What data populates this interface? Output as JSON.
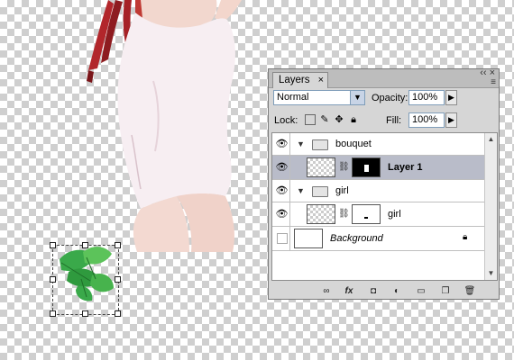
{
  "panel": {
    "tab_label": "Layers",
    "tab_close": "×",
    "window_controls": "‹‹ ×",
    "menu_icon": "≡",
    "blend_mode": "Normal",
    "opacity_label": "Opacity:",
    "opacity_value": "100%",
    "lock_label": "Lock:",
    "fill_label": "Fill:",
    "fill_value": "100%"
  },
  "layers": [
    {
      "name": "bouquet",
      "type": "group",
      "visible": true,
      "expanded": true
    },
    {
      "name": "Layer 1",
      "type": "layer",
      "visible": true,
      "selected": true,
      "bold": true
    },
    {
      "name": "girl",
      "type": "group",
      "visible": true,
      "expanded": true
    },
    {
      "name": "girl",
      "type": "layer",
      "visible": true
    },
    {
      "name": "Background",
      "type": "background",
      "visible": false,
      "italic": true,
      "locked": true
    }
  ],
  "bottom_icons": [
    "link-icon",
    "fx-icon",
    "mask-icon",
    "adjustment-icon",
    "group-icon",
    "new-layer-icon",
    "trash-icon"
  ],
  "bottom_fx": "fx",
  "colors": {
    "panel_bg": "#d6d6d6",
    "selected_row": "#b9bcc9",
    "accent_border": "#7f9db9"
  }
}
